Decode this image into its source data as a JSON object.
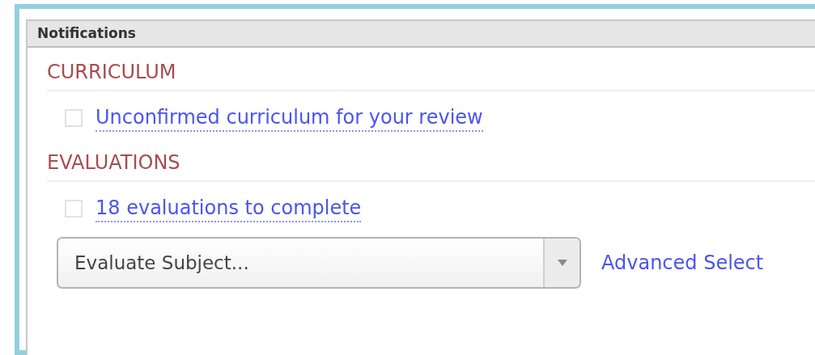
{
  "panel": {
    "title": "Notifications"
  },
  "sections": [
    {
      "heading": "CURRICULUM",
      "items": [
        {
          "checked": false,
          "link": "Unconfirmed curriculum for your review"
        }
      ]
    },
    {
      "heading": "EVALUATIONS",
      "items": [
        {
          "checked": false,
          "link": "18 evaluations to complete"
        }
      ]
    }
  ],
  "subject_select": {
    "value": "Evaluate Subject..."
  },
  "advanced_link": "Advanced Select"
}
